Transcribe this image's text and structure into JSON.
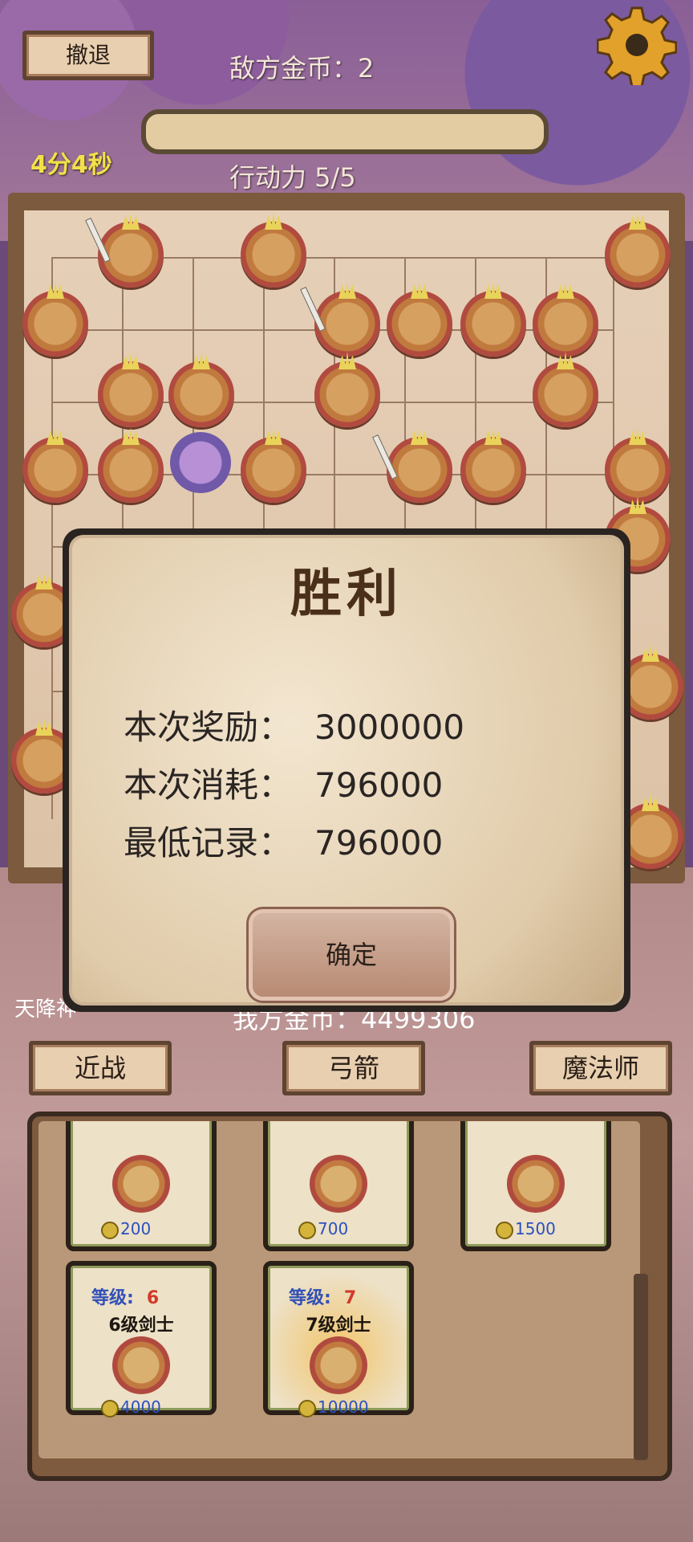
{
  "hud": {
    "retreat_label": "撤退",
    "enemy_gold": "敌方金币：2",
    "timer": "4分4秒",
    "action_points": "行动力 5/5",
    "ally_gold_partial": "我方金币：4499306",
    "left_label_partial": "天降神"
  },
  "tabs": [
    {
      "label": "近战"
    },
    {
      "label": "弓箭"
    },
    {
      "label": "魔法师"
    }
  ],
  "shop": {
    "cards": [
      {
        "price": "200"
      },
      {
        "price": "700"
      },
      {
        "price": "1500"
      },
      {
        "level_label": "等级:",
        "level": "6",
        "name": "6级剑士",
        "price": "4000"
      },
      {
        "level_label": "等级:",
        "level": "7",
        "name": "7级剑士",
        "price": "10000"
      }
    ]
  },
  "dialog": {
    "title": "胜利",
    "rows": [
      {
        "label": "本次奖励：",
        "value": "3000000"
      },
      {
        "label": "本次消耗：",
        "value": "796000"
      },
      {
        "label": "最低记录：",
        "value": "796000"
      }
    ],
    "confirm_label": "确定"
  },
  "colors": {
    "timer": "#f2e14a",
    "level_label": "#3150b8",
    "level_value": "#d33a2a",
    "price": "#2b50c0",
    "dialog_title": "#4a2f1a"
  },
  "icons": [
    "gear-icon",
    "coin-icon",
    "sword-icon"
  ]
}
